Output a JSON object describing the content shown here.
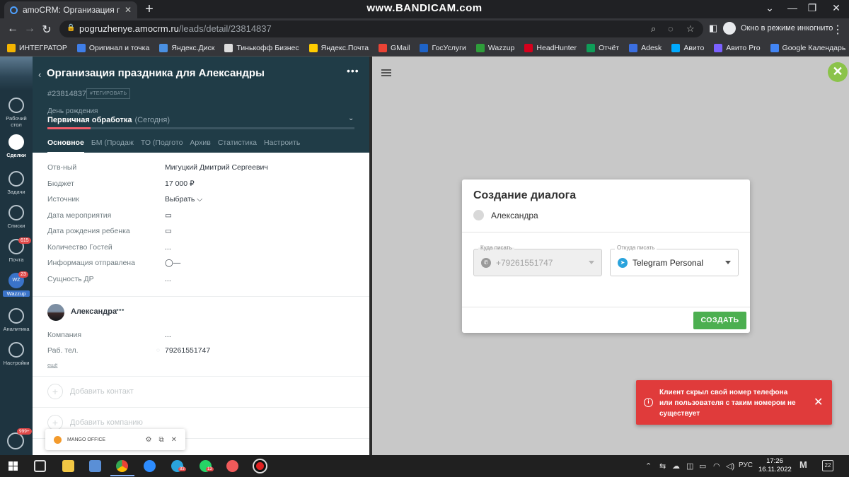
{
  "browser": {
    "tab_title": "amoCRM: Организация праздни",
    "tab_close": "✕",
    "new_tab": "+",
    "watermark": "www.BANDICAM.com",
    "url_host": "pogruzhenye.amocrm.ru",
    "url_path": "/leads/detail/23814837",
    "incognito_label": "Окно в режиме инкогнито",
    "window_controls": [
      "⌄",
      "—",
      "❐",
      "✕"
    ]
  },
  "bookmarks": [
    {
      "label": "ИНТЕГРАТОР",
      "color": "#f4b400"
    },
    {
      "label": "Оригинал и точка",
      "color": "#3f7ee8"
    },
    {
      "label": "Яндекс.Диск",
      "color": "#4a90e2"
    },
    {
      "label": "Тинькофф Бизнес",
      "color": "#dddddd"
    },
    {
      "label": "Яндекс.Почта",
      "color": "#ffcc00"
    },
    {
      "label": "GMail",
      "color": "#ea4335"
    },
    {
      "label": "ГосУслуги",
      "color": "#1e63c7"
    },
    {
      "label": "Wazzup",
      "color": "#2e9d3a"
    },
    {
      "label": "HeadHunter",
      "color": "#d6001c"
    },
    {
      "label": "Отчёт",
      "color": "#0f9d58"
    },
    {
      "label": "Adesk",
      "color": "#3b6fe0"
    },
    {
      "label": "Авито",
      "color": "#00aaff"
    },
    {
      "label": "Авито Pro",
      "color": "#7b61ff"
    },
    {
      "label": "Google Календарь",
      "color": "#4285f4"
    }
  ],
  "leftnav": {
    "items": [
      {
        "label": "Рабочий стол",
        "badge": ""
      },
      {
        "label": "Сделки",
        "badge": ""
      },
      {
        "label": "Задачи",
        "badge": ""
      },
      {
        "label": "Списки",
        "badge": ""
      },
      {
        "label": "Почта",
        "badge": "615"
      },
      {
        "label": "Wazzup",
        "badge": "23"
      },
      {
        "label": "Аналитика",
        "badge": ""
      },
      {
        "label": "Настройки",
        "badge": ""
      }
    ],
    "wazzup_short": "WZ",
    "chat_badge": "999+"
  },
  "lead": {
    "title": "Организация праздника для Александры",
    "more": "•••",
    "id": "#23814837",
    "tag_button": "#ТЕГИРОВАТЬ",
    "pipeline": "День рождения",
    "stage": "Первичная обработка",
    "stage_note": "(Сегодня)",
    "stage_progress": 0.14,
    "tabs": [
      "Основное",
      "БМ (Продаж",
      "ТО (Подгото",
      "Архив",
      "Статистика",
      "Настроить"
    ],
    "fields": [
      {
        "label": "Отв-ный",
        "value": "Мигуцкий Дмитрий Сергеевич"
      },
      {
        "label": "Бюджет",
        "value": "17 000  ₽"
      },
      {
        "label": "Источник",
        "value": "Выбрать ⌵"
      },
      {
        "label": "Дата мероприятия",
        "value": "▭"
      },
      {
        "label": "Дата рождения ребенка",
        "value": "▭"
      },
      {
        "label": "Количество Гостей",
        "value": "..."
      },
      {
        "label": "Информация отправлена",
        "value": "◯—"
      },
      {
        "label": "Сущность ДР",
        "value": "..."
      }
    ],
    "contact": {
      "name": "Александра",
      "more": "•••",
      "company_label": "Компания",
      "company_value": "...",
      "phone_label": "Раб. тел.",
      "phone_value": "79261551747",
      "more_link": "ещё"
    },
    "add_contact": "Добавить контакт",
    "add_company": "Добавить компанию"
  },
  "mango": {
    "label": "MANGO OFFICE"
  },
  "dialog": {
    "title": "Создание диалога",
    "user": "Александра",
    "to_label": "Куда писать",
    "to_value": "+79261551747",
    "from_label": "Откуда писать",
    "from_value": "Telegram Personal",
    "create_button": "СОЗДАТЬ"
  },
  "toast": {
    "message": "Клиент скрыл свой номер телефона или пользователя с таким номером не существует",
    "close": "✕"
  },
  "taskbar": {
    "lang": "РУС",
    "time": "17:26",
    "date": "16.11.2022",
    "notif_count": "22",
    "badges": {
      "telegram": "83",
      "whatsapp": "13"
    }
  },
  "colors": {
    "accent_green": "#4caf50",
    "error_red": "#e03b3b",
    "lead_header": "#203c47"
  }
}
